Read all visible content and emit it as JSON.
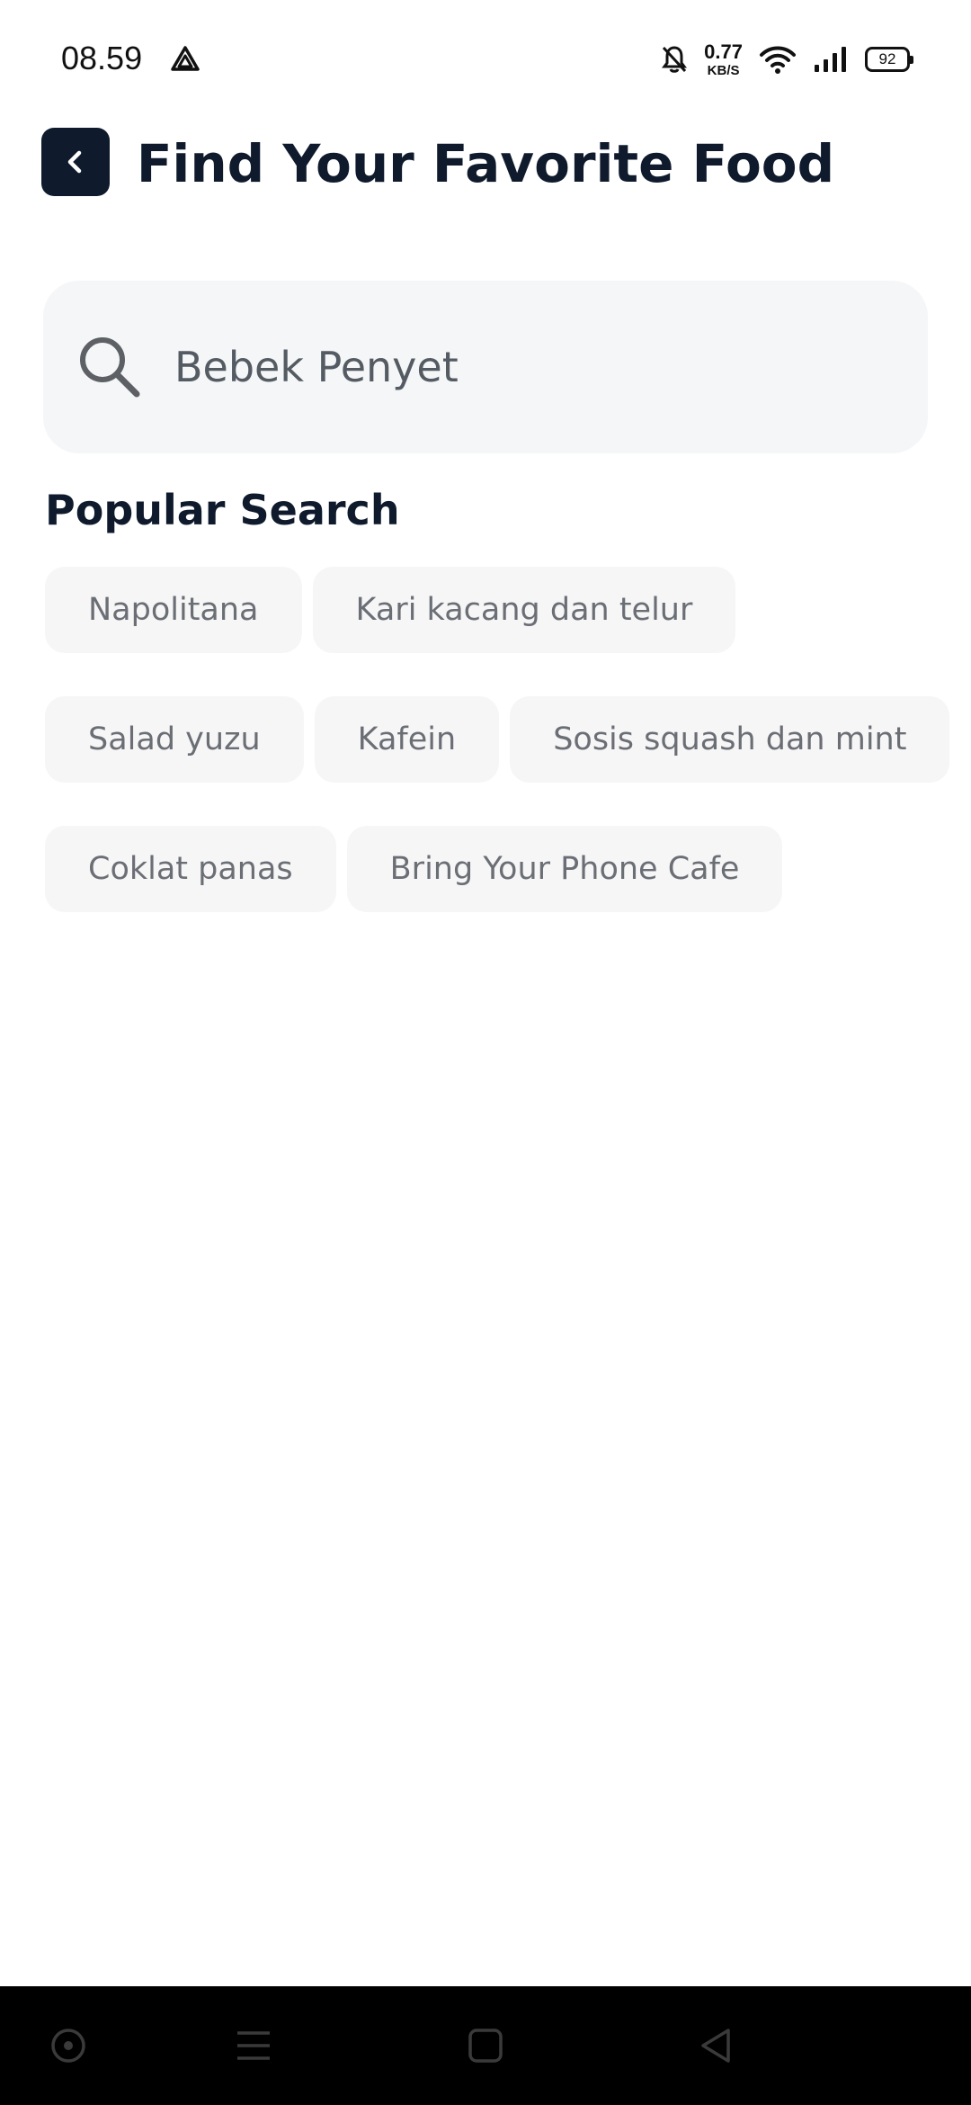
{
  "status_bar": {
    "time": "08.59",
    "net_speed_value": "0.77",
    "net_speed_unit": "KB/S",
    "battery": "92",
    "icons": [
      "drive-app-icon",
      "bell-muted-icon",
      "wifi-icon",
      "signal-icon",
      "battery-icon"
    ]
  },
  "header": {
    "title": "Find Your Favorite Food",
    "back_icon": "chevron-left-icon"
  },
  "search": {
    "value": "Bebek Penyet",
    "icon": "search-icon"
  },
  "popular": {
    "title": "Popular Search",
    "rows": [
      [
        "Napolitana",
        "Kari kacang dan telur"
      ],
      [
        "Salad yuzu",
        "Kafein",
        "Sosis squash dan mint"
      ],
      [
        "Coklat panas",
        "Bring Your Phone Cafe"
      ]
    ]
  },
  "nav_bar": {
    "icons": [
      "record-icon",
      "menu-icon",
      "home-square-icon",
      "back-triangle-icon"
    ]
  },
  "colors": {
    "primary": "#0f1b2d",
    "chip_bg": "#f6f6f7",
    "search_bg": "#f5f6f8"
  }
}
